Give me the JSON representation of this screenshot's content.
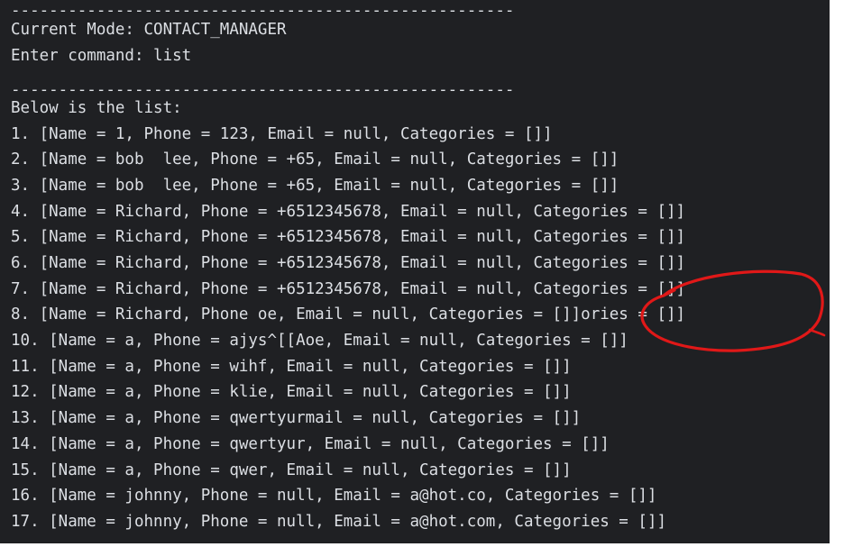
{
  "terminal": {
    "lines": [
      "-----------------------------------------------------",
      "Current Mode: CONTACT_MANAGER",
      "Enter command: list",
      "",
      "-----------------------------------------------------",
      "Below is the list:",
      "1. [Name = 1, Phone = 123, Email = null, Categories = []]",
      "2. [Name = bob  lee, Phone = +65, Email = null, Categories = []]",
      "3. [Name = bob  lee, Phone = +65, Email = null, Categories = []]",
      "4. [Name = Richard, Phone = +6512345678, Email = null, Categories = []]",
      "5. [Name = Richard, Phone = +6512345678, Email = null, Categories = []]",
      "6. [Name = Richard, Phone = +6512345678, Email = null, Categories = []]",
      "7. [Name = Richard, Phone = +6512345678, Email = null, Categories = []]",
      "8. [Name = Richard, Phone oe, Email = null, Categories = []]ories = []]",
      "10. [Name = a, Phone = ajys^[[Aoe, Email = null, Categories = []]",
      "11. [Name = a, Phone = wihf, Email = null, Categories = []]",
      "12. [Name = a, Phone = klie, Email = null, Categories = []]",
      "13. [Name = a, Phone = qwertyurmail = null, Categories = []]",
      "14. [Name = a, Phone = qwertyur, Email = null, Categories = []]",
      "15. [Name = a, Phone = qwer, Email = null, Categories = []]",
      "16. [Name = johnny, Phone = null, Email = a@hot.co, Categories = []]",
      "17. [Name = johnny, Phone = null, Email = a@hot.com, Categories = []]"
    ]
  },
  "colors": {
    "background": "#1f2023",
    "text": "#dcdfe4",
    "annotation": "#e01818"
  }
}
